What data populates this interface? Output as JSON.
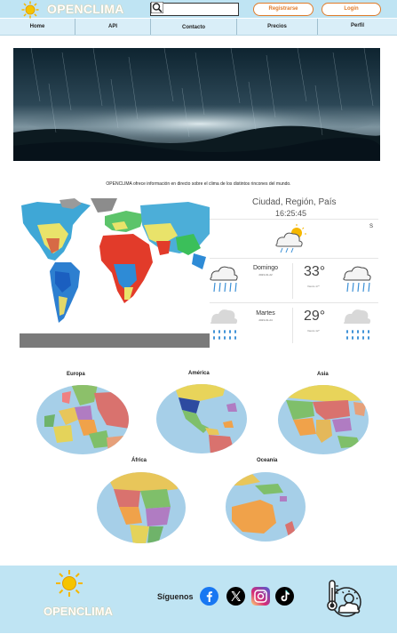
{
  "header": {
    "logo_text": "OPENCLIMA",
    "search": {
      "placeholder": ""
    },
    "register_label": "Registrarse",
    "login_label": "Login"
  },
  "nav": {
    "items": [
      {
        "label": "Home"
      },
      {
        "label": "API"
      },
      {
        "label": "Contacto"
      },
      {
        "label": "Precios"
      },
      {
        "label": "Perfil"
      }
    ]
  },
  "main": {
    "tagline": "OPENCLIMA ofrece información en directo sobre el clima de los distintos rincones del mundo."
  },
  "weather": {
    "location": "Ciudad, Región, País",
    "time": "16:25:45",
    "current_icon": "partly-cloudy-rain-icon",
    "edge_label": "S",
    "days": [
      {
        "name": "Domingo",
        "date": "2023-01-22",
        "temp": "33°",
        "sub": "Viento 17°",
        "icon": "cloud-rain-icon"
      },
      {
        "name": "Martes",
        "date": "2023-01-24",
        "temp": "29°",
        "sub": "Viento 12°",
        "icon": "cloud-drizzle-icon"
      }
    ]
  },
  "continents": [
    {
      "label": "Europa"
    },
    {
      "label": "América"
    },
    {
      "label": "Asia"
    },
    {
      "label": "África"
    },
    {
      "label": "Oceanía"
    }
  ],
  "footer": {
    "logo_text": "OPENCLIMA",
    "follow_label": "Síguenos",
    "social": [
      {
        "icon": "facebook-icon",
        "color": "#1877f2"
      },
      {
        "icon": "x-icon",
        "color": "#000000"
      },
      {
        "icon": "instagram-icon",
        "color": "#d62976"
      },
      {
        "icon": "tiktok-icon",
        "color": "#000000"
      }
    ]
  },
  "colors": {
    "header_bg": "#bfe4f3",
    "nav_bg": "#d9eef8",
    "accent": "#e07b2a",
    "sun": "#f5b700"
  }
}
